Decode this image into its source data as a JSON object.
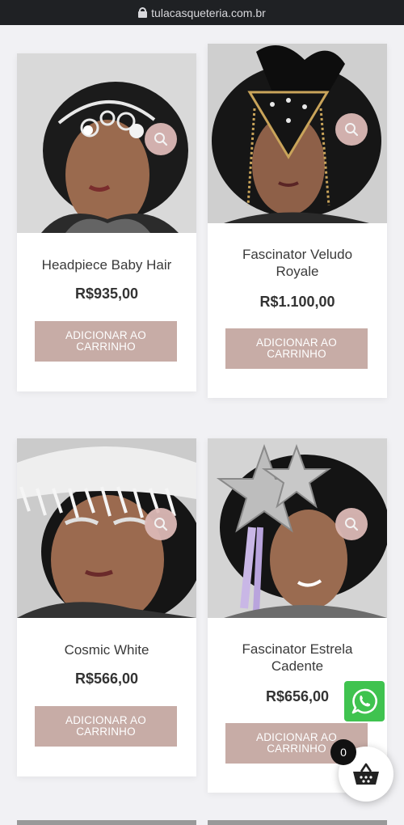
{
  "browser": {
    "url": "tulacasqueteria.com.br"
  },
  "products": [
    {
      "title": "Headpiece Baby Hair",
      "price": "R$935,00",
      "button_line1": "ADICIONAR AO",
      "button_line2": "CARRINHO",
      "zoom_icon": "magnifier-icon"
    },
    {
      "title_line1": "Fascinator Veludo",
      "title_line2": "Royale",
      "price": "R$1.100,00",
      "button_line1": "ADICIONAR AO",
      "button_line2": "CARRINHO",
      "zoom_icon": "magnifier-icon"
    },
    {
      "title": "Cosmic White",
      "price": "R$566,00",
      "button_line1": "ADICIONAR AO",
      "button_line2": "CARRINHO",
      "zoom_icon": "magnifier-icon"
    },
    {
      "title_line1": "Fascinator Estrela",
      "title_line2": "Cadente",
      "price": "R$656,00",
      "button_line1": "ADICIONAR AO",
      "button_line2": "CARRINHO",
      "zoom_icon": "magnifier-icon"
    }
  ],
  "cart": {
    "count": "0",
    "icon": "basket-icon"
  },
  "whatsapp": {
    "icon": "whatsapp-icon"
  },
  "colors": {
    "button": "#c7aca6",
    "zoom": "#dcb9b6",
    "whatsapp": "#3fc34f",
    "background": "#f1f1f4"
  }
}
